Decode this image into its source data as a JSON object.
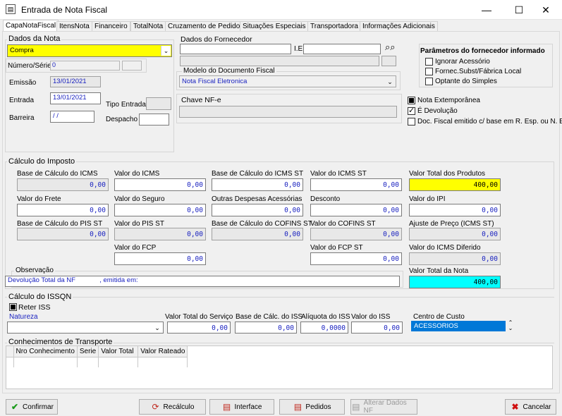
{
  "window": {
    "title": "Entrada de Nota Fiscal",
    "minimize": "—",
    "maximize": "☐",
    "close": "✕"
  },
  "tabs": [
    "CapaNotaFiscal",
    "ItensNota",
    "Financeiro",
    "TotalNota",
    "Cruzamento de Pedidos",
    "Situações Especiais",
    "Transportadora",
    "Informações Adicionais"
  ],
  "dados_nota": {
    "group": "Dados da Nota",
    "operacao": "Compra",
    "numero_serie_label": "Número/Série",
    "numero": "0",
    "emissao_label": "Emissão",
    "emissao": "13/01/2021",
    "entrada_label": "Entrada",
    "entrada": "13/01/2021",
    "tipo_entrada_label": "Tipo Entrada",
    "barreira_label": "Barreira",
    "barreira": " / /",
    "despacho_label": "Despacho"
  },
  "fornecedor": {
    "group": "Dados do Fornecedor",
    "ie_label": "I.E",
    "modelo_group": "Modelo do Documento Fiscal",
    "modelo": "Nota Fiscal Eletronica",
    "chave_label": "Chave NF-e"
  },
  "parametros": {
    "title": "Parâmetros do fornecedor informado",
    "items": [
      "Ignorar Acessório",
      "Fornec.Subst/Fábrica Local",
      "Optante do Simples"
    ]
  },
  "flags": {
    "extemporanea": "Nota Extemporânea",
    "devolucao": "É Devolução",
    "doc_fiscal": "Doc. Fiscal emitido c/ base em R. Esp. ou N. E."
  },
  "calculo": {
    "group": "Cálculo do Imposto",
    "fields": [
      {
        "label": "Base de Cálculo do ICMS",
        "value": "0,00"
      },
      {
        "label": "Valor do  ICMS",
        "value": "0,00"
      },
      {
        "label": "Base de Cálculo do ICMS ST",
        "value": "0,00"
      },
      {
        "label": "Valor do ICMS ST",
        "value": "0,00"
      },
      {
        "label": "Valor Total  dos Produtos",
        "value": "400,00"
      },
      {
        "label": "Valor do Frete",
        "value": "0,00"
      },
      {
        "label": "Valor do Seguro",
        "value": "0,00"
      },
      {
        "label": "Outras Despesas Acessórias",
        "value": "0,00"
      },
      {
        "label": "Desconto",
        "value": "0,00"
      },
      {
        "label": "Valor do IPI",
        "value": "0,00"
      },
      {
        "label": "Base de Cálculo do PIS ST",
        "value": "0,00"
      },
      {
        "label": "Valor do PIS ST",
        "value": "0,00"
      },
      {
        "label": "Base de Cálculo do COFINS ST",
        "value": "0,00"
      },
      {
        "label": "Valor do COFINS ST",
        "value": "0,00"
      },
      {
        "label": "Ajuste de Preço (ICMS ST)",
        "value": "0,00"
      },
      {
        "label": "Valor do  FCP",
        "value": "0,00"
      },
      {
        "label": "Valor do FCP ST",
        "value": "0,00"
      },
      {
        "label": "Valor do ICMS Diferido",
        "value": "0,00"
      }
    ],
    "observacao_label": "Observação",
    "observacao": "Devolução Total da NF             , emitida em:",
    "total_nota_label": "Valor Total da Nota",
    "total_nota": "400,00"
  },
  "issqn": {
    "group": "Cálculo do ISSQN",
    "reter_iss": "Reter ISS",
    "natureza_label": "Natureza",
    "valor_servico_label": "Valor Total do Serviço",
    "valor_servico": "0,00",
    "base_iss_label": "Base de Cálc. do ISS",
    "base_iss": "0,00",
    "aliquota_label": "Alíquota do ISS",
    "aliquota": "0,0000",
    "valor_iss_label": "Valor do ISS",
    "valor_iss": "0,00",
    "centro_custo_label": "Centro de Custo",
    "centro_custo": "ACESSORIOS"
  },
  "conhecimentos": {
    "group": "Conhecimentos de Transporte",
    "columns": [
      "Nro Conhecimento",
      "Serie",
      "Valor Total",
      "Valor Rateado"
    ]
  },
  "buttons": {
    "confirmar": "Confirmar",
    "recalculo": "Recálculo",
    "interface": "Interface",
    "pedidos": "Pedidos",
    "alterar": "Alterar Dados NF",
    "cancelar": "Cancelar"
  },
  "colors": {
    "yellow": "#ffff00",
    "cyan": "#00ffff",
    "selection": "#0078d7"
  }
}
